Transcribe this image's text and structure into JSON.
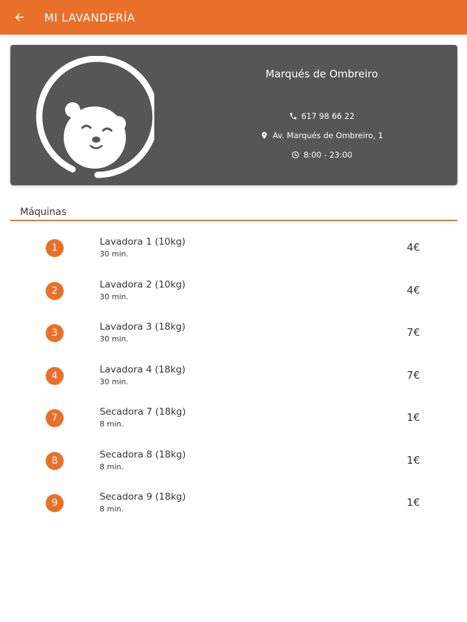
{
  "appbar": {
    "title": "MI LAVANDERÍA",
    "back_icon": "arrow-back-icon",
    "color": "#e8702a"
  },
  "store": {
    "name": "Marqués de Ombreiro",
    "phone": "617 98 66 22",
    "address": "Av. Marqués de Ombreiro, 1",
    "hours": "8:00 - 23:00",
    "card_color": "#565656",
    "logo_icon": "bear-logo-icon"
  },
  "machines": {
    "section_title": "Máquinas",
    "items": [
      {
        "number": "1",
        "name": "Lavadora 1 (10kg)",
        "duration": "30 min.",
        "price": "4€"
      },
      {
        "number": "2",
        "name": "Lavadora 2 (10kg)",
        "duration": "30 min.",
        "price": "4€"
      },
      {
        "number": "3",
        "name": "Lavadora 3 (18kg)",
        "duration": "30 min.",
        "price": "7€"
      },
      {
        "number": "4",
        "name": "Lavadora 4 (18kg)",
        "duration": "30 min.",
        "price": "7€"
      },
      {
        "number": "7",
        "name": "Secadora 7 (18kg)",
        "duration": "8 min.",
        "price": "1€"
      },
      {
        "number": "8",
        "name": "Secadora 8 (18kg)",
        "duration": "8 min.",
        "price": "1€"
      },
      {
        "number": "9",
        "name": "Secadora 9 (18kg)",
        "duration": "8 min.",
        "price": "1€"
      }
    ]
  }
}
